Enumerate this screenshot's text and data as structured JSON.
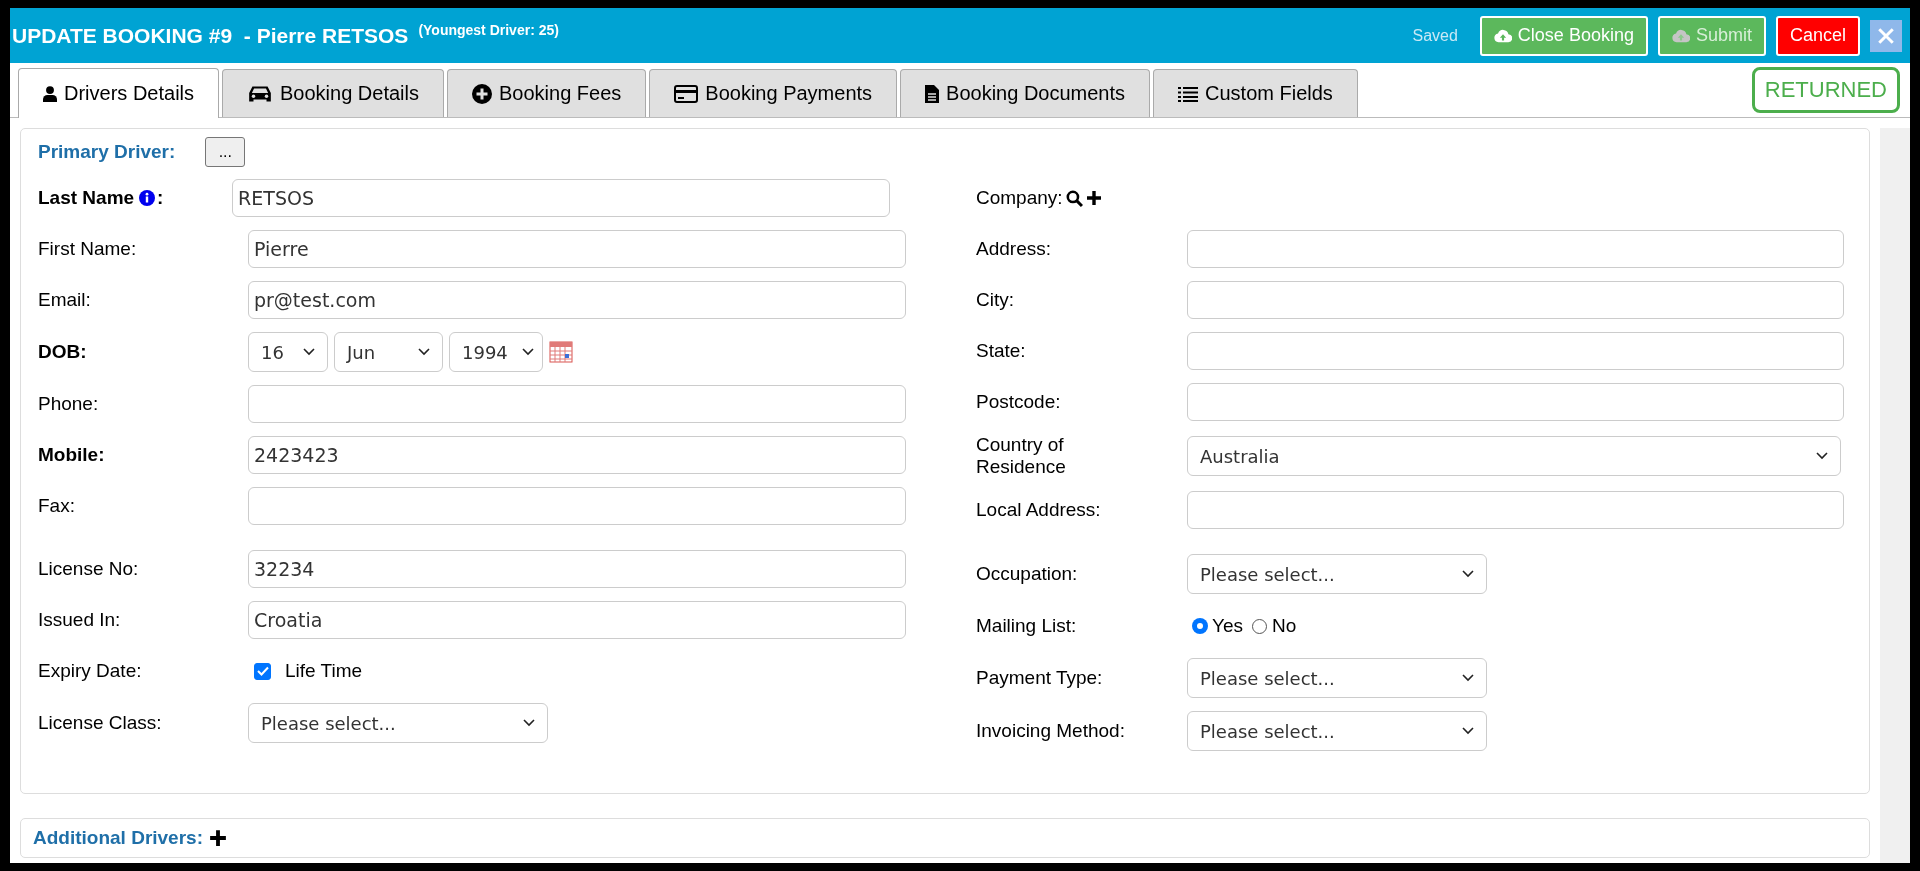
{
  "header": {
    "title": "UPDATE BOOKING #9  - Pierre RETSOS",
    "subtitle": "(Youngest Driver: 25)",
    "status": "Saved",
    "buttons": [
      {
        "kind": "upload",
        "label": "Close Booking",
        "disabled": false
      },
      {
        "kind": "upload",
        "label": "Submit",
        "disabled": true
      },
      {
        "kind": "danger",
        "label": "Cancel",
        "disabled": false
      },
      {
        "kind": "close",
        "disabled": false
      }
    ]
  },
  "tabs": [
    {
      "label": "Drivers Details",
      "selected": true
    },
    {
      "label": "Booking Details",
      "selected": false
    },
    {
      "label": "Booking Fees",
      "selected": false
    },
    {
      "label": "Booking Payments",
      "selected": false
    },
    {
      "label": "Booking Documents",
      "selected": false
    },
    {
      "label": "Custom Fields",
      "selected": false
    }
  ],
  "booking_status": "RETURNED",
  "primary_driver": {
    "title": "Primary Driver:",
    "more_button": "...",
    "left_groups": [
      [
        {
          "kind": "text",
          "label": "Last Name",
          "suffix": ":",
          "bold": true,
          "info": true,
          "value": "RETSOS"
        },
        {
          "kind": "text",
          "label": "First Name:",
          "bold": false,
          "info": false,
          "value": "Pierre"
        },
        {
          "kind": "text",
          "label": "Email:",
          "bold": false,
          "info": false,
          "value": "pr@test.com"
        },
        {
          "kind": "dob",
          "label": "DOB:",
          "bold": true,
          "info": false,
          "parts": [
            "16",
            "Jun",
            "1994"
          ]
        },
        {
          "kind": "text",
          "label": "Phone:",
          "bold": false,
          "info": false
        },
        {
          "kind": "text",
          "label": "Mobile:",
          "bold": true,
          "info": false,
          "value": "2423423"
        },
        {
          "kind": "text",
          "label": "Fax:",
          "bold": false,
          "info": false
        }
      ],
      [
        {
          "kind": "text",
          "label": "License No:",
          "bold": false,
          "info": false,
          "value": "32234"
        },
        {
          "kind": "text",
          "label": "Issued In:",
          "bold": false,
          "info": false,
          "value": "Croatia"
        },
        {
          "kind": "checkbox",
          "label": "Expiry Date:",
          "bold": false,
          "info": false,
          "option": "Life Time",
          "checked": true
        },
        {
          "kind": "select",
          "label": "License Class:",
          "bold": false,
          "info": false,
          "value": "Please select..."
        }
      ]
    ],
    "right_groups": [
      [
        {
          "kind": "lookup",
          "label": "Company:",
          "bold": false,
          "info": false
        },
        {
          "kind": "text",
          "label": "Address:",
          "bold": false,
          "info": false
        },
        {
          "kind": "text",
          "label": "City:",
          "bold": false,
          "info": false
        },
        {
          "kind": "text",
          "label": "State:",
          "bold": false,
          "info": false
        },
        {
          "kind": "text",
          "label": "Postcode:",
          "bold": false,
          "info": false
        },
        {
          "kind": "wideselect",
          "label": "Country of Residence",
          "bold": false,
          "info": false,
          "value": "Australia"
        },
        {
          "kind": "text",
          "label": "Local Address:",
          "bold": false,
          "info": false
        }
      ],
      [
        {
          "kind": "select",
          "label": "Occupation:",
          "bold": false,
          "info": false,
          "value": "Please select..."
        },
        {
          "kind": "radio",
          "label": "Mailing List:",
          "bold": false,
          "info": false,
          "options": [
            {
              "label": "Yes",
              "selected": true
            },
            {
              "label": "No",
              "selected": false
            }
          ]
        },
        {
          "kind": "select",
          "label": "Payment Type:",
          "bold": false,
          "info": false,
          "value": "Please select..."
        },
        {
          "kind": "select",
          "label": "Invoicing Method:",
          "bold": false,
          "info": false,
          "value": "Please select..."
        }
      ]
    ]
  },
  "additional_drivers": {
    "title": "Additional Drivers:"
  }
}
